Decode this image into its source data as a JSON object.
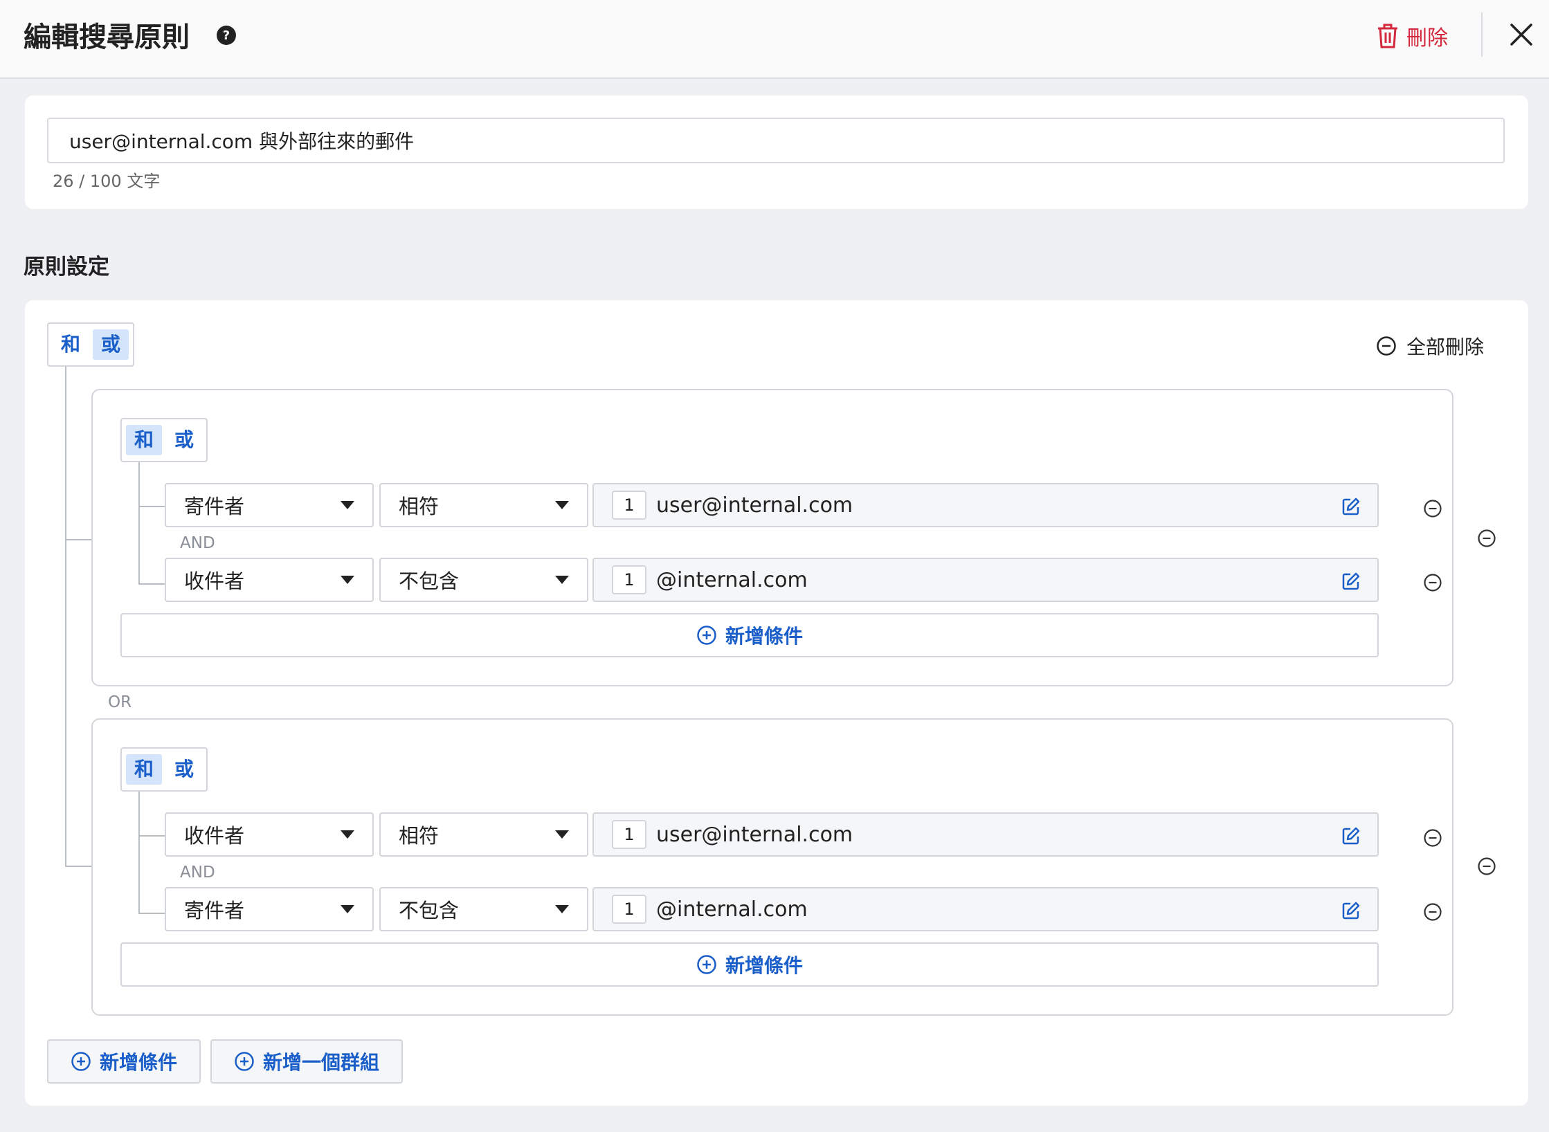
{
  "header": {
    "title": "編輯搜尋原則",
    "delete_label": "刪除"
  },
  "name_field": {
    "value": "user@internal.com 與外部往來的郵件",
    "char_count": "26 / 100 文字"
  },
  "rules": {
    "section_title": "原則設定",
    "top_toggle": {
      "and": "和",
      "or": "或",
      "selected": "或"
    },
    "remove_all_label": "全部刪除",
    "or_label": "OR",
    "groups": [
      {
        "toggle": {
          "and": "和",
          "or": "或",
          "selected": "和"
        },
        "conditions": [
          {
            "field": "寄件者",
            "operator": "相符",
            "count": "1",
            "value": "user@internal.com"
          },
          {
            "field": "收件者",
            "operator": "不包含",
            "count": "1",
            "value": "@internal.com"
          }
        ],
        "and_label": "AND",
        "add_condition_label": "新增條件"
      },
      {
        "toggle": {
          "and": "和",
          "or": "或",
          "selected": "和"
        },
        "conditions": [
          {
            "field": "收件者",
            "operator": "相符",
            "count": "1",
            "value": "user@internal.com"
          },
          {
            "field": "寄件者",
            "operator": "不包含",
            "count": "1",
            "value": "@internal.com"
          }
        ],
        "and_label": "AND",
        "add_condition_label": "新增條件"
      }
    ],
    "add_condition_label": "新增條件",
    "add_group_label": "新增一個群組"
  },
  "colors": {
    "accent_blue": "#1a5fc9",
    "toggle_active_bg": "#d4e4fb",
    "danger_red": "#d3283c",
    "page_bg": "#eff0f3"
  }
}
